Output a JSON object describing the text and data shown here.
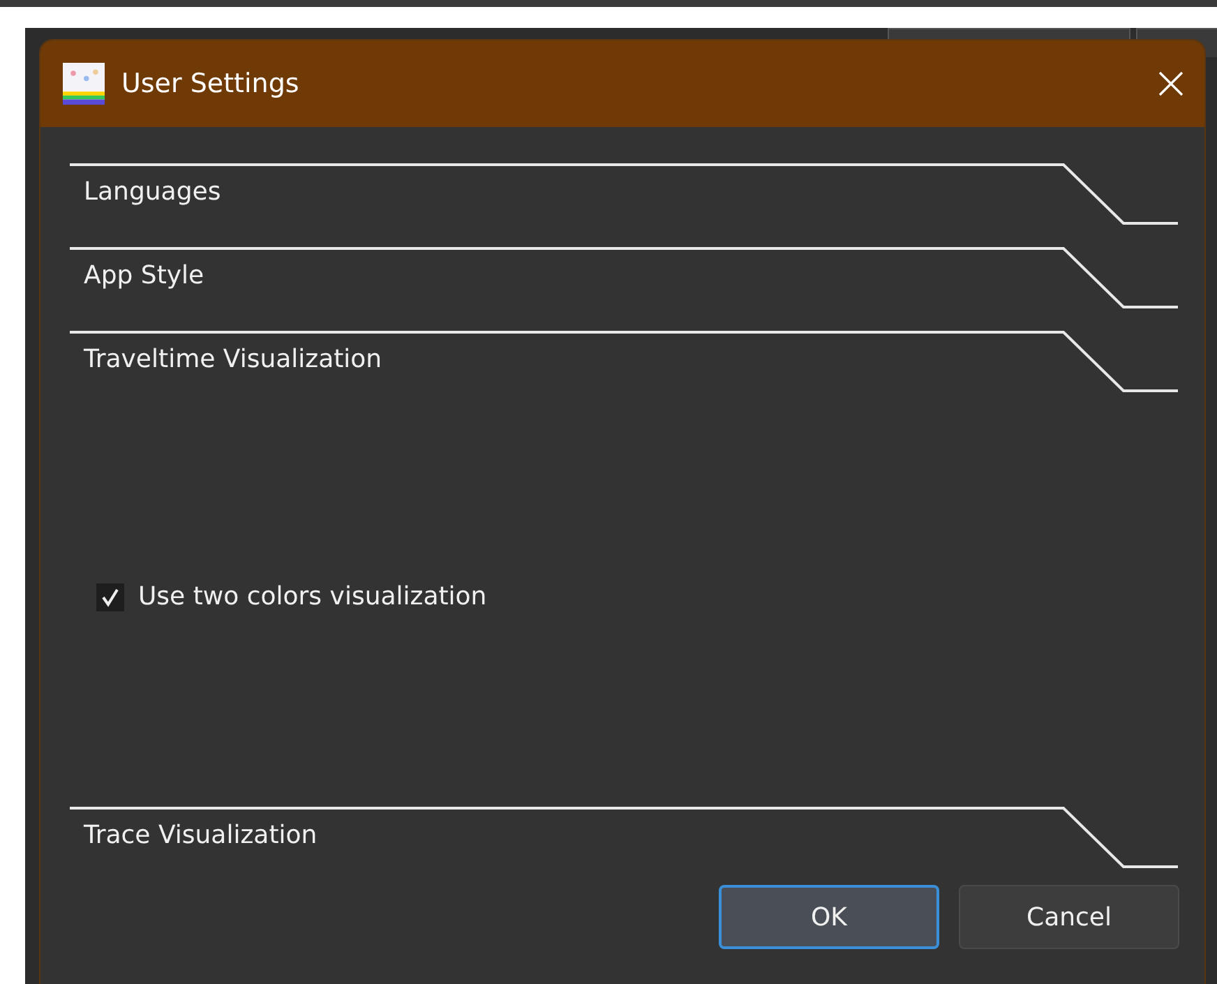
{
  "window": {
    "title": "User Settings"
  },
  "sections": [
    {
      "title": "Languages"
    },
    {
      "title": "App Style"
    },
    {
      "title": "Traveltime Visualization",
      "options": [
        {
          "label": "Use two colors visualization",
          "checked": true
        }
      ]
    },
    {
      "title": "Trace Visualization"
    }
  ],
  "buttons": [
    {
      "label": "OK",
      "kind": "default"
    },
    {
      "label": "Cancel",
      "kind": "normal"
    }
  ]
}
